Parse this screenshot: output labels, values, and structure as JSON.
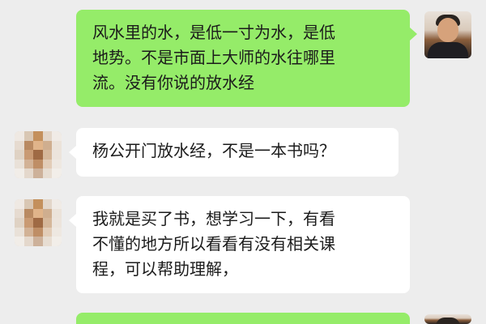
{
  "messages": [
    {
      "side": "right",
      "lines": [
        "风水里的水，是低一寸为水，是低",
        "地势。不是市面上大师的水往哪里",
        "流。没有你说的放水经"
      ]
    },
    {
      "side": "left",
      "lines": [
        "杨公开门放水经，不是一本书吗？"
      ]
    },
    {
      "side": "left",
      "lines": [
        "我就是买了书，想学习一下，有看",
        "不懂的地方所以看看有没有相关课",
        "程，可以帮助理解，"
      ]
    },
    {
      "side": "right",
      "lines": []
    }
  ],
  "colors": {
    "background": "#ededed",
    "sent_bubble": "#95ec69",
    "received_bubble": "#ffffff",
    "text": "#1b1b1b"
  }
}
